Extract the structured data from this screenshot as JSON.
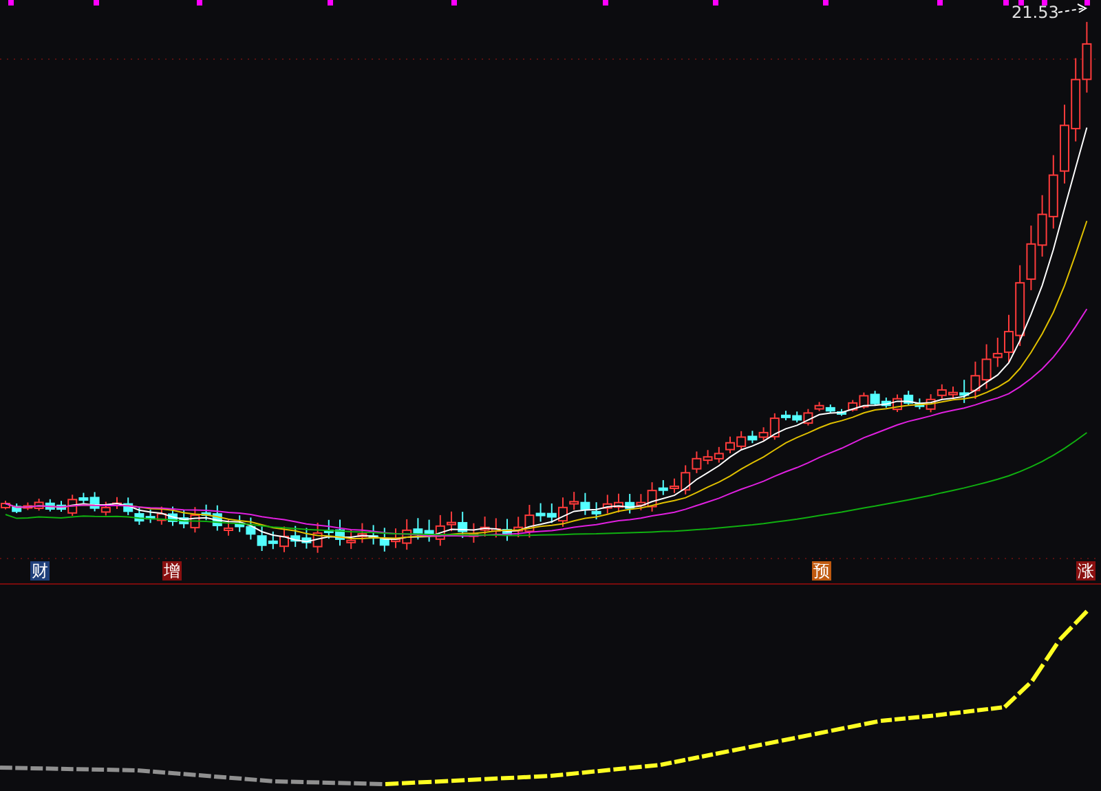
{
  "price_chart": {
    "high_label": "21.53"
  },
  "event_markers": [
    {
      "text": "财",
      "color": "#1f3f7a"
    },
    {
      "text": "增",
      "color": "#8a1010"
    },
    {
      "text": "预",
      "color": "#c05a10"
    },
    {
      "text": "涨",
      "color": "#8a1010"
    }
  ]
}
